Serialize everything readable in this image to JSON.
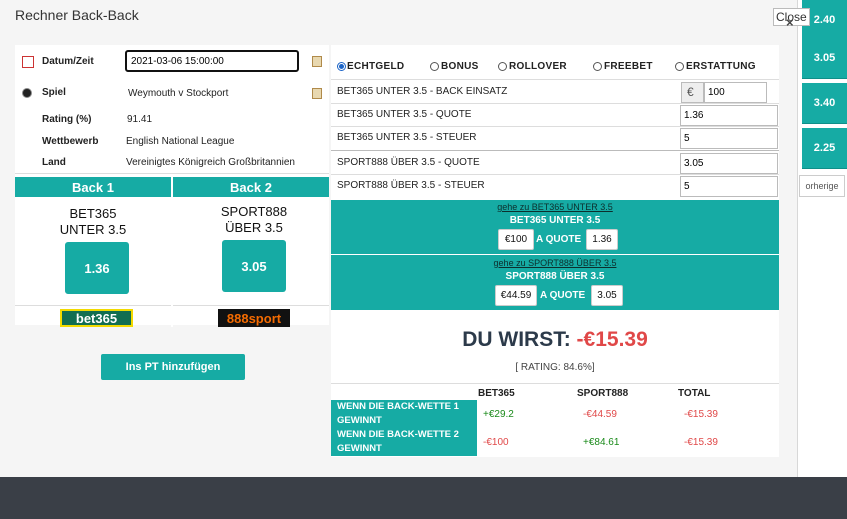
{
  "dialog": {
    "title": "Rechner Back-Back",
    "close_label": "Close",
    "close_x": "×"
  },
  "sidebar_odds": [
    "2.40",
    "3.05",
    "3.40",
    "2.25"
  ],
  "vorherige_label": "orherige",
  "info": {
    "datetime_label": "Datum/Zeit",
    "datetime_value": "2021-03-06 15:00:00",
    "match_label": "Spiel",
    "match_value": "Weymouth v Stockport",
    "rating_label": "Rating (%)",
    "rating_value": "91.41",
    "competition_label": "Wettbewerb",
    "competition_value": "English National League",
    "country_label": "Land",
    "country_value": "Vereinigtes Königreich Großbritannien"
  },
  "back1": {
    "header": "Back 1",
    "bookmaker": "BET365",
    "market": "UNTER 3.5",
    "odds": "1.36",
    "logo_text": "bet365"
  },
  "back2": {
    "header": "Back 2",
    "bookmaker": "SPORT888",
    "market": "ÜBER 3.5",
    "odds": "3.05",
    "logo_text": "888sport"
  },
  "add_button": "Ins PT hinzufügen",
  "modes": [
    {
      "label": "ECHTGELD",
      "selected": true
    },
    {
      "label": "BONUS",
      "selected": false
    },
    {
      "label": "ROLLOVER",
      "selected": false
    },
    {
      "label": "FREEBET",
      "selected": false
    },
    {
      "label": "ERSTATTUNG",
      "selected": false
    }
  ],
  "form": {
    "stake_label": "BET365 UNTER 3.5 - BACK EINSATZ",
    "currency": "€",
    "stake_value": "100",
    "quote1_label": "BET365 UNTER 3.5 - QUOTE",
    "quote1_value": "1.36",
    "tax1_label": "BET365 UNTER 3.5 - STEUER",
    "tax1_value": "5",
    "quote2_label": "SPORT888 ÜBER 3.5  - QUOTE",
    "quote2_value": "3.05",
    "tax2_label": "SPORT888 ÜBER 3.5 - STEUER",
    "tax2_value": "5"
  },
  "go1": {
    "link": "gehe zu BET365 UNTER 3.5",
    "title": "BET365 UNTER 3.5",
    "amount": "€100",
    "quote_label": "A QUOTE",
    "quote": "1.36"
  },
  "go2": {
    "link": "gehe zu SPORT888 ÜBER 3.5",
    "title": "SPORT888 ÜBER 3.5",
    "amount": "€44.59",
    "quote_label": "A QUOTE",
    "quote": "3.05"
  },
  "result": {
    "prefix": "DU WIRST:",
    "value": "-€15.39",
    "rating": "[ RATING: 84.6%]"
  },
  "table": {
    "headers": [
      "BET365",
      "SPORT888",
      "TOTAL"
    ],
    "rows": [
      {
        "label": "WENN DIE BACK-WETTE 1 GEWINNT",
        "values": [
          "+€29.2",
          "-€44.59",
          "-€15.39"
        ]
      },
      {
        "label": "WENN DIE BACK-WETTE 2 GEWINNT",
        "values": [
          "-€100",
          "+€84.61",
          "-€15.39"
        ]
      }
    ]
  },
  "colors": {
    "teal": "#16aba4",
    "negative": "#e04848",
    "positive": "#1a8a1a"
  }
}
